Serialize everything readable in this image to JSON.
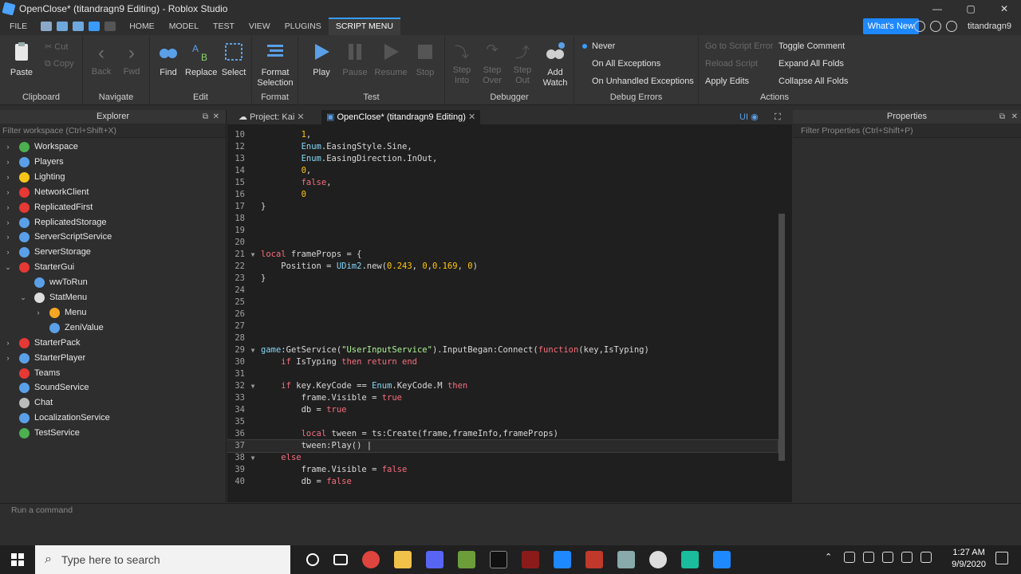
{
  "window": {
    "title": "OpenClose* (titandragn9 Editing) - Roblox Studio",
    "min": "—",
    "max": "▢",
    "close": "✕"
  },
  "menubar": {
    "file": "FILE",
    "tabs": [
      "HOME",
      "MODEL",
      "TEST",
      "VIEW",
      "PLUGINS",
      "SCRIPT MENU"
    ],
    "whats_new": "What's New",
    "user": "titandragn9"
  },
  "ribbon": {
    "clipboard": {
      "title": "Clipboard",
      "paste": "Paste",
      "cut": "Cut",
      "copy": "Copy"
    },
    "navigate": {
      "title": "Navigate",
      "back": "Back",
      "fwd": "Fwd"
    },
    "edit": {
      "title": "Edit",
      "find": "Find",
      "replace": "Replace",
      "select": "Select"
    },
    "format": {
      "title": "Format",
      "btn": "Format Selection"
    },
    "test": {
      "title": "Test",
      "play": "Play",
      "pause": "Pause",
      "resume": "Resume",
      "stop": "Stop"
    },
    "debugger": {
      "title": "Debugger",
      "step_into": "Step Into",
      "step_over": "Step Over",
      "step_out": "Step Out",
      "add_watch": "Add Watch"
    },
    "debug_errors": {
      "title": "Debug Errors",
      "never": "Never",
      "all": "On All Exceptions",
      "unhandled": "On Unhandled Exceptions"
    },
    "actions": {
      "title": "Actions",
      "go_to_error": "Go to Script Error",
      "reload": "Reload Script",
      "apply": "Apply Edits",
      "toggle": "Toggle Comment",
      "expand": "Expand All Folds",
      "collapse": "Collapse All Folds"
    }
  },
  "explorer": {
    "title": "Explorer",
    "filter": "Filter workspace (Ctrl+Shift+X)",
    "items": [
      "Workspace",
      "Players",
      "Lighting",
      "NetworkClient",
      "ReplicatedFirst",
      "ReplicatedStorage",
      "ServerScriptService",
      "ServerStorage",
      "StarterGui",
      "wwToRun",
      "StatMenu",
      "Menu",
      "ZeniValue",
      "StarterPack",
      "StarterPlayer",
      "Teams",
      "SoundService",
      "Chat",
      "LocalizationService",
      "TestService"
    ]
  },
  "editor": {
    "tab1": "Project: Kai",
    "tab2": "OpenClose* (titandragn9 Editing)",
    "ui_label": "UI"
  },
  "properties": {
    "title": "Properties",
    "filter": "Filter Properties (Ctrl+Shift+P)"
  },
  "command_bar": "Run a command",
  "taskbar": {
    "search": "Type here to search",
    "time": "1:27 AM",
    "date": "9/9/2020"
  }
}
